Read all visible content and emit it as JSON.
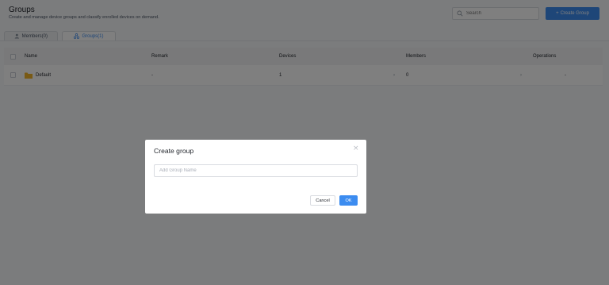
{
  "header": {
    "title": "Groups",
    "description": "Create and manage device groups and classify enrolled devices on demand.",
    "search_placeholder": "Search",
    "create_button": "Create Group"
  },
  "tabs": [
    {
      "label": "Members(0)",
      "icon": "user-icon",
      "active": false
    },
    {
      "label": "Groups(1)",
      "icon": "group-icon",
      "active": true
    }
  ],
  "table": {
    "columns": [
      "Name",
      "Remark",
      "Devices",
      "Members",
      "Operations"
    ],
    "rows": [
      {
        "name": "Default",
        "remark": "-",
        "devices": "1",
        "members": "0",
        "operations": "-"
      }
    ]
  },
  "modal": {
    "title": "Create group",
    "input_placeholder": "Add Group Name",
    "input_value": "",
    "cancel_label": "Cancel",
    "ok_label": "OK"
  },
  "colors": {
    "accent": "#3c8cf0",
    "folder": "#f2b52a",
    "overlay": "rgba(0,0,0,0.5)"
  }
}
